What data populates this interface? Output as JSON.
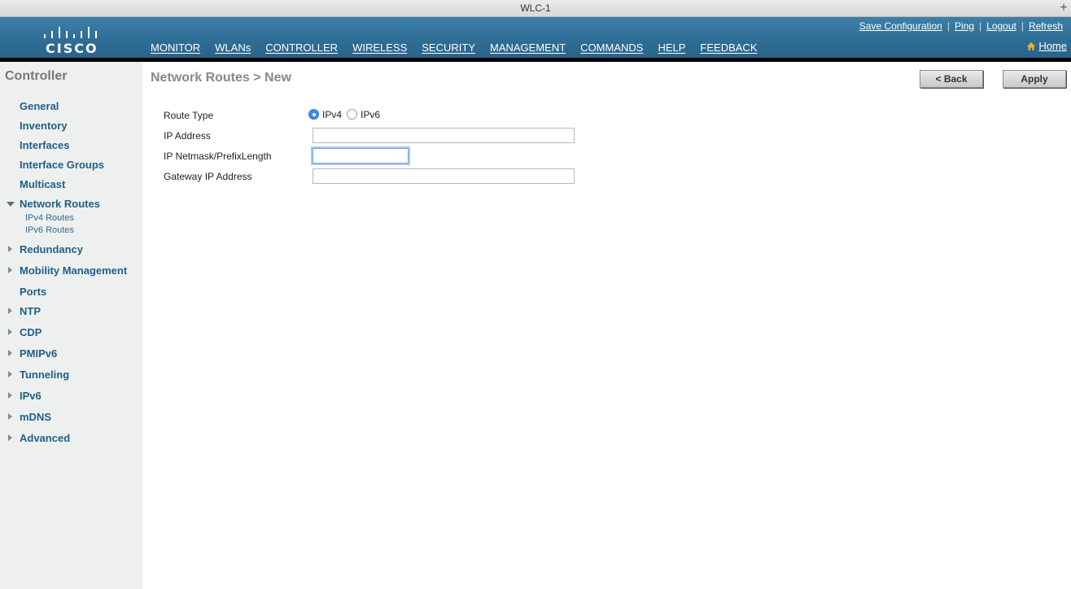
{
  "window": {
    "title": "WLC-1",
    "new_tab": "+"
  },
  "brand": {
    "logo_text": "CISCO"
  },
  "header": {
    "links": [
      "Save Configuration",
      "Ping",
      "Logout",
      "Refresh"
    ],
    "separator": "|",
    "home_label": "Home"
  },
  "nav": [
    "MONITOR",
    "WLANs",
    "CONTROLLER",
    "WIRELESS",
    "SECURITY",
    "MANAGEMENT",
    "COMMANDS",
    "HELP",
    "FEEDBACK"
  ],
  "nav_active": "CONTROLLER",
  "sidebar": {
    "title": "Controller",
    "items": [
      "General",
      "Inventory",
      "Interfaces",
      "Interface Groups",
      "Multicast",
      "Network Routes",
      "Redundancy",
      "Mobility Management",
      "Ports",
      "NTP",
      "CDP",
      "PMIPv6",
      "Tunneling",
      "IPv6",
      "mDNS",
      "Advanced"
    ],
    "subitems": [
      "IPv4 Routes",
      "IPv6 Routes"
    ]
  },
  "main": {
    "title": "Network Routes > New",
    "back_label": "< Back",
    "apply_label": "Apply",
    "form": {
      "route_type_label": "Route Type",
      "route_type_options": [
        "IPv4",
        "IPv6"
      ],
      "route_type_selected": "IPv4",
      "ip_address_label": "IP Address",
      "ip_address_value": "",
      "netmask_label": "IP Netmask/PrefixLength",
      "netmask_value": "",
      "gateway_label": "Gateway IP Address",
      "gateway_value": ""
    }
  },
  "colors": {
    "header": "#2f6e96",
    "active_tab": "#f08c2a",
    "sidebar_link": "#1f5f86",
    "radio_selected": "#3b8ee6"
  }
}
